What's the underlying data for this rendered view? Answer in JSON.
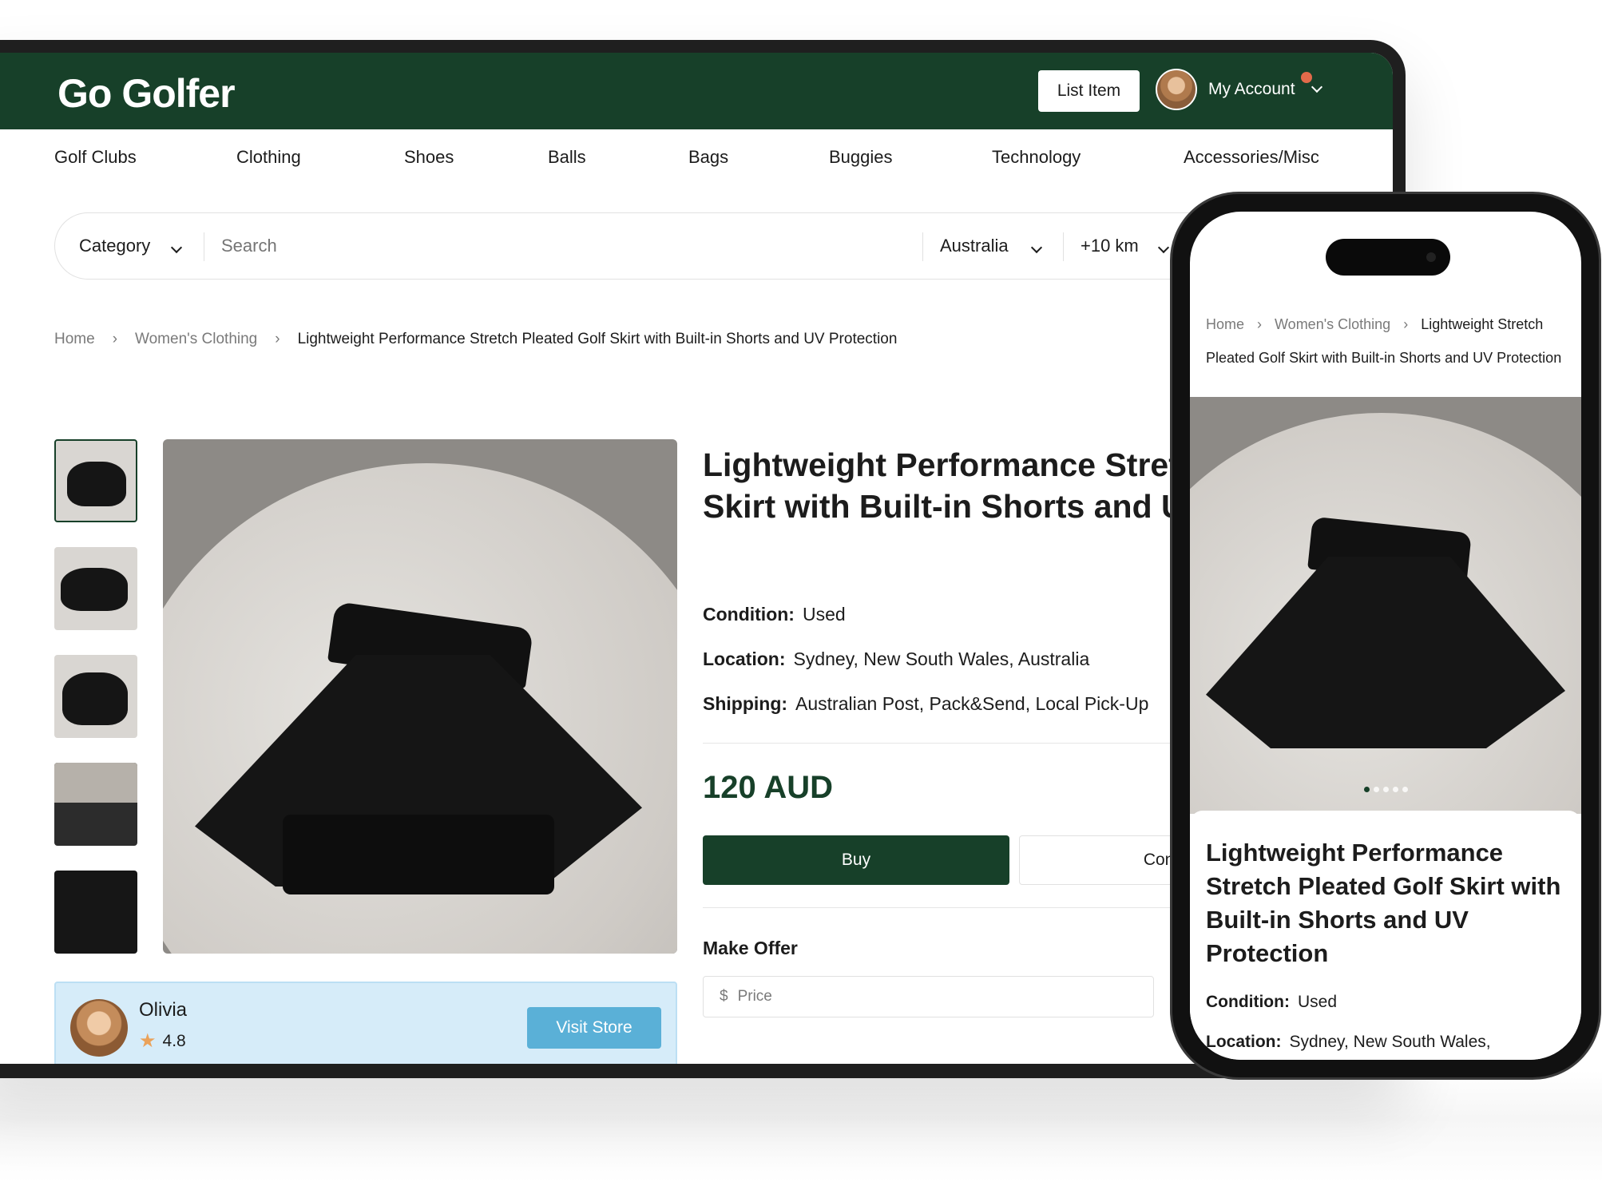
{
  "header": {
    "logo": "Go Golfer",
    "list_item_label": "List Item",
    "account_label": "My Account"
  },
  "categories": [
    "Golf Clubs",
    "Clothing",
    "Shoes",
    "Balls",
    "Bags",
    "Buggies",
    "Technology",
    "Accessories/Misc"
  ],
  "search": {
    "category_label": "Category",
    "placeholder": "Search",
    "country": "Australia",
    "radius": "+10 km"
  },
  "breadcrumb": {
    "home": "Home",
    "section": "Women's Clothing",
    "current": "Lightweight Performance Stretch Pleated Golf Skirt with Built-in Shorts and UV Protection"
  },
  "product": {
    "title": "Lightweight Performance Stretch Pleated Golf Skirt with Built-in Shorts and UV Protection",
    "condition_label": "Condition:",
    "condition": "Used",
    "location_label": "Location:",
    "location": "Sydney, New South Wales, Australia",
    "shipping_label": "Shipping:",
    "shipping": "Australian Post, Pack&Send, Local Pick-Up",
    "price": "120 AUD",
    "buy_label": "Buy",
    "contact_label": "Contact",
    "make_offer_label": "Make Offer",
    "offer_currency": "$",
    "offer_placeholder": "Price"
  },
  "seller": {
    "name": "Olivia",
    "rating": "4.8",
    "visit_label": "Visit Store"
  },
  "mobile": {
    "breadcrumb_home": "Home",
    "breadcrumb_section": "Women's Clothing",
    "breadcrumb_current": "Lightweight Stretch Pleated Golf Skirt with Built-in Shorts and UV Protection",
    "title": "Lightweight Performance Stretch Pleated Golf Skirt with Built-in Shorts and UV Protection",
    "condition_label": "Condition:",
    "condition": "Used",
    "location_label": "Location:",
    "location": "Sydney, New South Wales,",
    "carousel_active_index": 1,
    "carousel_count": 5
  },
  "colors": {
    "brand_green": "#174029",
    "seller_card": "#d6ecf9",
    "visit_button": "#5ab0d7",
    "notification": "#e26a4a",
    "star": "#eaa25a"
  }
}
